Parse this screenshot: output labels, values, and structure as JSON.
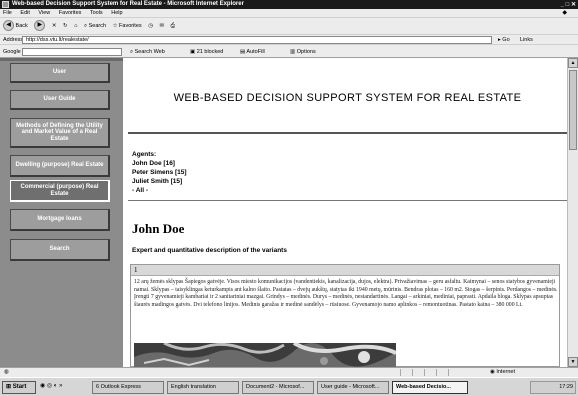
{
  "window": {
    "title": "Web-based Decision Support System for Real Estate - Microsoft Internet Explorer",
    "controls": "_ □ ✕"
  },
  "menu": [
    "File",
    "Edit",
    "View",
    "Favorites",
    "Tools",
    "Help"
  ],
  "toolbar": {
    "back": "Back",
    "search": "Search",
    "favorites": "Favorites"
  },
  "address": {
    "label": "Address",
    "url": "http://dss.vtu.lt/realestate/",
    "go": "Go",
    "links": "Links"
  },
  "google": {
    "label": "Google -",
    "search_web": "Search Web",
    "blocked": "21 blocked",
    "autofill": "AutoFill",
    "options": "Options"
  },
  "sidebar": {
    "items": [
      {
        "label": "User"
      },
      {
        "label": "User Guide"
      },
      {
        "label": "Methods of Defining the Utility and Market Value of a Real Estate"
      },
      {
        "label": "Dwelling (purpose) Real Estate"
      },
      {
        "label": "Commercial (purpose) Real Estate"
      },
      {
        "label": "Mortgage loans"
      },
      {
        "label": "Search"
      }
    ]
  },
  "content": {
    "site_title": "WEB-BASED DECISION SUPPORT SYSTEM FOR REAL ESTATE",
    "agents_label": "Agents:",
    "agents": [
      "John Doe [16]",
      "Peter Simens [15]",
      "Juliet Smith [15]",
      "- All -"
    ],
    "person_name": "John Doe",
    "description_heading": "Expert and quantitative description of the variants",
    "variant_number": "1",
    "variant_text": "12 arų žemės sklypas Šapiegos gatvėje. Visos miesto komunikacijos (vandentiekis, kanalizacija, dujos, elektra). Privažiavimas – geru asfaltu. Kaimynai – senos statybos gyvenamieji namai. Sklypas – taisyklingas keturkampis ant kalno šlaito. Pastatas – dvejų aukštų, statytas iki 1940 metų, mūrinis. Bendras plotas – 160 m2. Stogas – šerpinis. Perdangos – medinės. Įrengti 7 gyvenamieji kambariai ir 2 sanitariniai mazgai. Grindys – medinės. Durys – medinės, nestandartinės. Langai – arkiniai, mediniai, paprasti. Apdaila bloga. Sklypas apsuptas šiaurės madingos gatvės. Dvi telefono linijos. Medinis garažas ir medinė sandėlys – rūsiuose. Gyvenamojo namo aplinkos – remontuotinas. Pastato kaina – 380 000 Lt."
  },
  "statusbar": {
    "zone": "Internet"
  },
  "taskbar": {
    "start": "Start",
    "tasks": [
      "6 Outlook Express",
      "English translation",
      "Document2 - Microsof...",
      "User guide - Microsoft...",
      "Web-based Decisio..."
    ],
    "time": "17:29"
  }
}
